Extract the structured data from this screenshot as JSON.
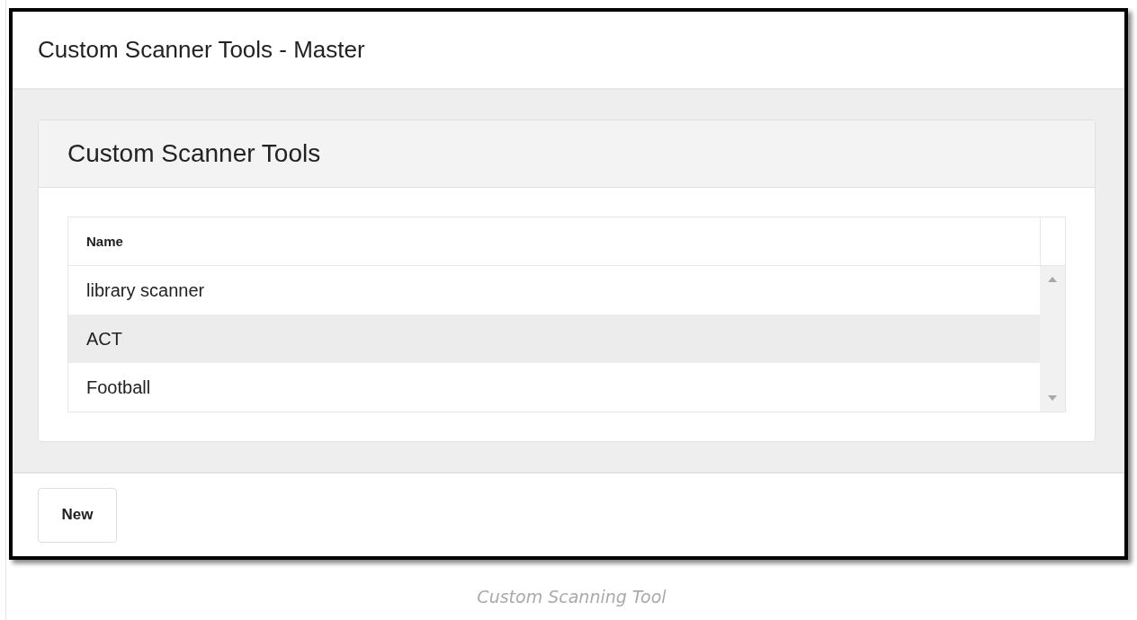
{
  "window": {
    "title": "Custom Scanner Tools - Master"
  },
  "panel": {
    "title": "Custom Scanner Tools"
  },
  "table": {
    "columns": [
      "Name"
    ],
    "rows": [
      {
        "name": "library scanner",
        "selected": false
      },
      {
        "name": "ACT",
        "selected": true
      },
      {
        "name": "Football",
        "selected": false
      }
    ]
  },
  "buttons": [
    "New"
  ],
  "caption": "Custom Scanning Tool"
}
